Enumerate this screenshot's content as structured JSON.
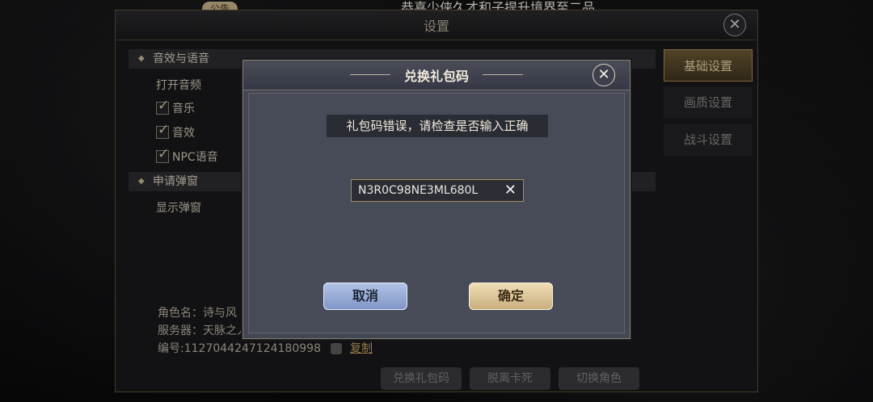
{
  "top_bar": {
    "notice_tag": "公告",
    "marquee": "恭喜少侠久才和子提升境界至二品"
  },
  "settings": {
    "title": "设置",
    "side_tabs": [
      {
        "label": "基础设置",
        "active": true
      },
      {
        "label": "画质设置",
        "active": false
      },
      {
        "label": "战斗设置",
        "active": false
      }
    ],
    "sections": {
      "audio": {
        "title": "音效与语音",
        "open_audio_label": "打开音频",
        "options": [
          {
            "label": "音乐",
            "checked": true
          },
          {
            "label": "音效",
            "checked": true
          },
          {
            "label": "NPC语音",
            "checked": true
          }
        ]
      },
      "popup": {
        "title": "申请弹窗",
        "show_popup_label": "显示弹窗"
      }
    },
    "info": {
      "role_name": "角色名：诗与风",
      "server": "服务器：天脉之人",
      "id": "编号:1127044247124180998",
      "copy_label": "复制"
    },
    "bottom_buttons": [
      "兑换礼包码",
      "脱离卡死",
      "切换角色"
    ]
  },
  "dialog": {
    "title": "兑换礼包码",
    "error_message": "礼包码错误，请检查是否输入正确",
    "code_value": "N3R0C98NE3ML680L",
    "cancel_label": "取消",
    "confirm_label": "确定"
  },
  "colors": {
    "accent_gold": "#c9b48b",
    "dialog_bg": "#434753",
    "cancel_blue": "#9fb2dc",
    "confirm_gold": "#e2cc9f"
  }
}
